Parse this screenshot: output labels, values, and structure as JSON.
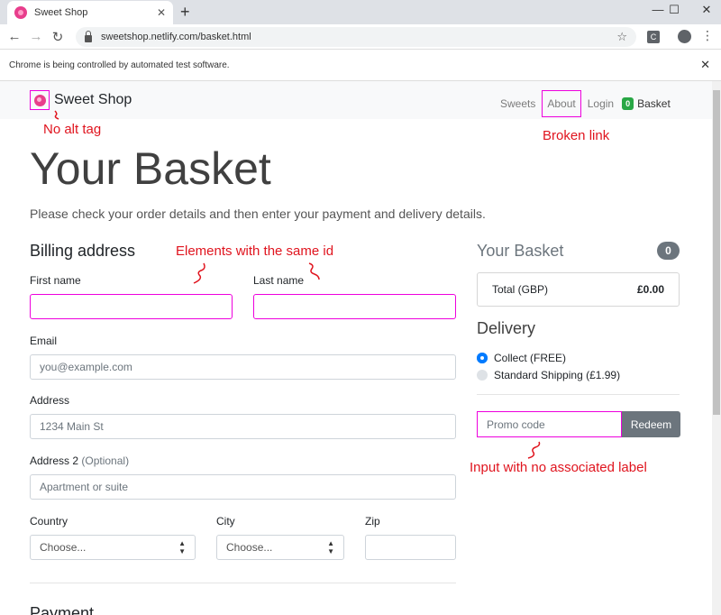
{
  "browser": {
    "tab_title": "Sweet Shop",
    "tab_close": "✕",
    "new_tab": "+",
    "url": "sweetshop.netlify.com/basket.html",
    "ext_label": "C",
    "infobar_text": "Chrome is being controlled by automated test software.",
    "win_min": "—",
    "win_max": "☐",
    "win_close": "✕",
    "back": "←",
    "forward": "→",
    "reload": "↻",
    "star": "☆",
    "menu": "⋮",
    "info_close": "✕"
  },
  "navbar": {
    "brand": "Sweet Shop",
    "links": [
      "Sweets",
      "About",
      "Login"
    ],
    "basket_count": "0",
    "basket_label": "Basket"
  },
  "page": {
    "title": "Your Basket",
    "lead": "Please check your order details and then enter your payment and delivery details."
  },
  "billing": {
    "heading": "Billing address",
    "first_name_label": "First name",
    "last_name_label": "Last name",
    "email_label": "Email",
    "email_placeholder": "you@example.com",
    "address_label": "Address",
    "address_placeholder": "1234 Main St",
    "address2_label": "Address 2",
    "address2_optional": "(Optional)",
    "address2_placeholder": "Apartment or suite",
    "country_label": "Country",
    "country_value": "Choose...",
    "city_label": "City",
    "city_value": "Choose...",
    "zip_label": "Zip",
    "payment_heading": "Payment"
  },
  "basket": {
    "title": "Your Basket",
    "count": "0",
    "total_label": "Total (GBP)",
    "total_value": "£0.00",
    "delivery_title": "Delivery",
    "options": [
      "Collect (FREE)",
      "Standard Shipping (£1.99)"
    ],
    "promo_placeholder": "Promo code",
    "redeem_label": "Redeem"
  },
  "annotations": {
    "no_alt": "No alt tag",
    "broken_link": "Broken link",
    "same_id": "Elements with the same id",
    "no_label": "Input with no associated label",
    "color": "#e0141e"
  },
  "colors": {
    "highlight": "#ee00dd",
    "brand": "#e83e8c",
    "badge_green": "#28a745",
    "secondary": "#6c757d",
    "primary": "#007bff"
  }
}
